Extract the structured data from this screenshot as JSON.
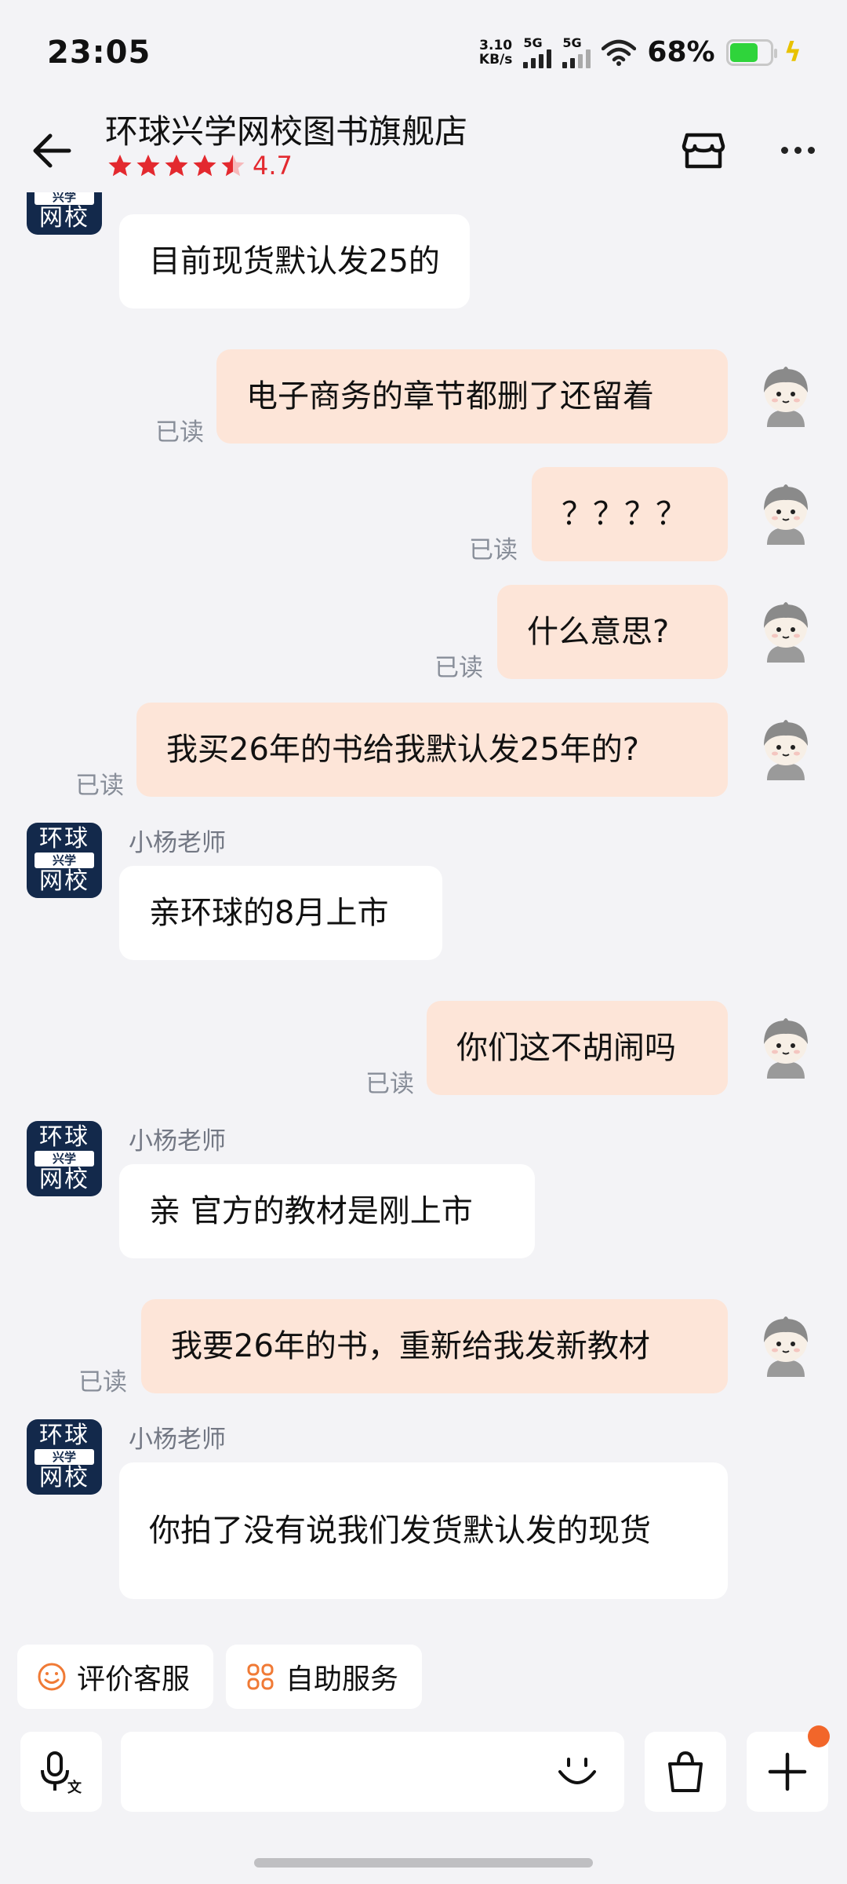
{
  "status_bar": {
    "time": "23:05",
    "net_speed_value": "3.10",
    "net_speed_unit": "KB/s",
    "sim1": "5G",
    "sim2": "5G",
    "battery_percent": "68%",
    "battery_level": 0.68,
    "icons": [
      "signal-icon",
      "wifi-icon",
      "battery-icon",
      "charging-bolt-icon"
    ]
  },
  "header": {
    "shop_name": "环球兴学网校图书旗舰店",
    "rating": "4.7",
    "rating_stars": 4.5,
    "icons": [
      "back-arrow-icon",
      "store-icon",
      "more-icon"
    ]
  },
  "shop_avatar": {
    "line1": "环球",
    "line2": "兴学",
    "line3": "网校"
  },
  "messages": [
    {
      "side": "in",
      "text": "目前现货默认发25的"
    },
    {
      "side": "out",
      "text": "电子商务的章节都删了还留着",
      "status": "已读"
    },
    {
      "side": "out",
      "text": "？？？？",
      "status": "已读"
    },
    {
      "side": "out",
      "text": "什么意思?",
      "status": "已读"
    },
    {
      "side": "out",
      "text": "我买26年的书给我默认发25年的?",
      "status": "已读"
    },
    {
      "side": "in",
      "sender": "小杨老师",
      "text": "亲环球的8月上市"
    },
    {
      "side": "out",
      "text": "你们这不胡闹吗",
      "status": "已读"
    },
    {
      "side": "in",
      "sender": "小杨老师",
      "text": "亲 官方的教材是刚上市"
    },
    {
      "side": "out",
      "text": "我要26年的书，重新给我发新教材",
      "status": "已读"
    },
    {
      "side": "in",
      "sender": "小杨老师",
      "text": "你拍了没有说我们发货默认发的现货"
    }
  ],
  "quick_actions": [
    {
      "label": "评价客服",
      "icon": "smile-icon"
    },
    {
      "label": "自助服务",
      "icon": "grid-icon"
    }
  ],
  "input_bar": {
    "icons": [
      "voice-to-text-icon",
      "emoji-icon",
      "shopping-bag-icon",
      "plus-icon"
    ],
    "badge_color": "#f2662a"
  },
  "colors": {
    "outgoing_bubble": "#fde5d8",
    "incoming_bubble": "#ffffff",
    "rating": "#e3292f",
    "shop_avatar_bg": "#13294b"
  }
}
